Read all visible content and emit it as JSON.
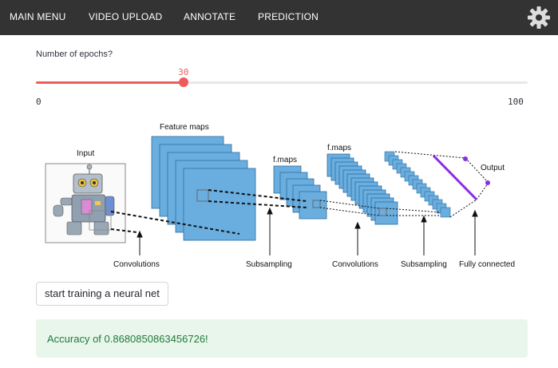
{
  "nav": {
    "items": [
      "MAIN MENU",
      "VIDEO UPLOAD",
      "ANNOTATE",
      "PREDICTION"
    ],
    "settings_icon": "gear-icon"
  },
  "slider": {
    "label": "Number of epochs?",
    "value": 30,
    "min": 0,
    "max": 100,
    "value_text": "30",
    "min_text": "0",
    "max_text": "100",
    "color": "#ee5b5b"
  },
  "diagram": {
    "input_label": "Input",
    "feature_maps_label": "Feature maps",
    "fmaps_label_1": "f.maps",
    "fmaps_label_2": "f.maps",
    "output_label": "Output",
    "stage_labels": [
      "Convolutions",
      "Subsampling",
      "Convolutions",
      "Subsampling",
      "Fully connected"
    ],
    "map_color": "#6aaee0",
    "output_line_color": "#8a2be2"
  },
  "actions": {
    "train_button": "start training a neural net"
  },
  "result": {
    "message": "Accuracy of 0.8680850863456726!",
    "color": "#e8f6ec"
  }
}
